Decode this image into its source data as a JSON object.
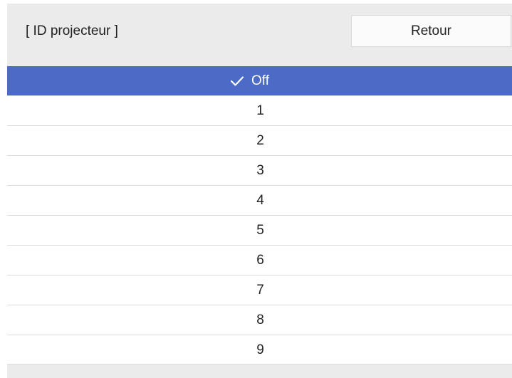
{
  "header": {
    "title": "[ ID projecteur ]",
    "back_label": "Retour"
  },
  "options": [
    {
      "label": "Off",
      "selected": true
    },
    {
      "label": "1",
      "selected": false
    },
    {
      "label": "2",
      "selected": false
    },
    {
      "label": "3",
      "selected": false
    },
    {
      "label": "4",
      "selected": false
    },
    {
      "label": "5",
      "selected": false
    },
    {
      "label": "6",
      "selected": false
    },
    {
      "label": "7",
      "selected": false
    },
    {
      "label": "8",
      "selected": false
    },
    {
      "label": "9",
      "selected": false
    }
  ],
  "colors": {
    "selected_background": "#4b6bc6",
    "header_background": "#ebebeb"
  },
  "icons": {
    "selected_marker": "check-icon"
  }
}
